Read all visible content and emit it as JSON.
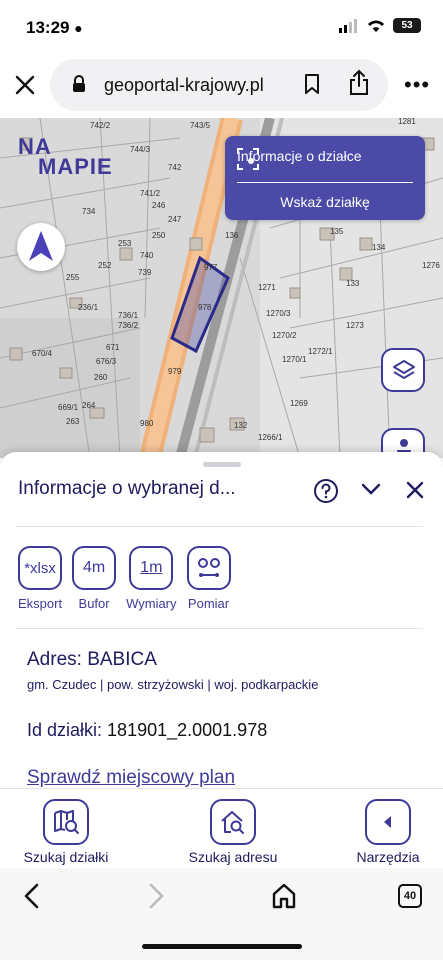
{
  "status": {
    "time": "13:29",
    "battery": "53"
  },
  "browser": {
    "url": "geoportal-krajowy.pl"
  },
  "map": {
    "logo_line1": "NA",
    "logo_line2": "MAPIE",
    "info_button": "Informacje o działce",
    "show_parcel_button": "Wskaż działkę",
    "parcel_labels": [
      {
        "t": "742/2"
      },
      {
        "t": "743/5"
      },
      {
        "t": "744/3"
      },
      {
        "t": "741/2"
      },
      {
        "t": "742"
      },
      {
        "t": "246"
      },
      {
        "t": "734"
      },
      {
        "t": "247"
      },
      {
        "t": "740"
      },
      {
        "t": "253"
      },
      {
        "t": "739"
      },
      {
        "t": "250"
      },
      {
        "t": "252"
      },
      {
        "t": "255"
      },
      {
        "t": "236/1"
      },
      {
        "t": "736/1"
      },
      {
        "t": "736/2"
      },
      {
        "t": "671"
      },
      {
        "t": "676/3"
      },
      {
        "t": "670/4"
      },
      {
        "t": "260"
      },
      {
        "t": "669/1"
      },
      {
        "t": "264"
      },
      {
        "t": "263"
      },
      {
        "t": "980"
      },
      {
        "t": "979"
      },
      {
        "t": "978"
      },
      {
        "t": "977"
      },
      {
        "t": "136"
      },
      {
        "t": "135"
      },
      {
        "t": "134"
      },
      {
        "t": "1271"
      },
      {
        "t": "1270/3"
      },
      {
        "t": "1270/2"
      },
      {
        "t": "1270/1"
      },
      {
        "t": "1272/1"
      },
      {
        "t": "1273"
      },
      {
        "t": "1269"
      },
      {
        "t": "1266/1"
      },
      {
        "t": "132"
      },
      {
        "t": "1276"
      },
      {
        "t": "1281"
      },
      {
        "t": "133"
      }
    ]
  },
  "sheet": {
    "title": "Informacje o wybranej d...",
    "tools": [
      {
        "icon_text": "*xlsx",
        "label": "Eksport"
      },
      {
        "icon_text": "4m",
        "label": "Bufor"
      },
      {
        "icon_text": "1m",
        "label": "Wymiary"
      },
      {
        "icon_text": "",
        "label": "Pomiar"
      }
    ],
    "address_prefix": "Adres: ",
    "address": "BABICA",
    "sub_address": "gm. Czudec | pow. strzyżowski | woj. podkarpackie",
    "id_prefix": "Id działki: ",
    "id_value": "181901_2.0001.978",
    "plan_link": "Sprawdź miejscowy plan"
  },
  "nav": {
    "search_parcel": "Szukaj działki",
    "search_address": "Szukaj adresu",
    "tools": "Narzędzia"
  },
  "safari": {
    "tab_count": "40"
  },
  "colors": {
    "accent": "#3f3a98",
    "highlight": "#4b4aa7",
    "road": "#f0b27a"
  }
}
